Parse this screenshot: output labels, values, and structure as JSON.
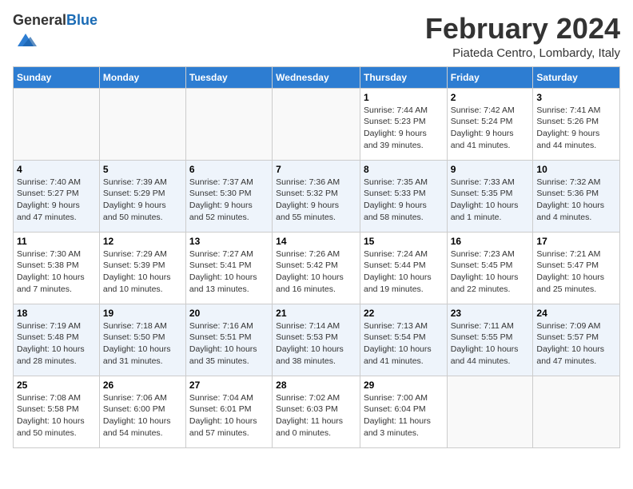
{
  "logo": {
    "general": "General",
    "blue": "Blue"
  },
  "header": {
    "month": "February 2024",
    "location": "Piateda Centro, Lombardy, Italy"
  },
  "weekdays": [
    "Sunday",
    "Monday",
    "Tuesday",
    "Wednesday",
    "Thursday",
    "Friday",
    "Saturday"
  ],
  "weeks": [
    [
      {
        "day": "",
        "info": ""
      },
      {
        "day": "",
        "info": ""
      },
      {
        "day": "",
        "info": ""
      },
      {
        "day": "",
        "info": ""
      },
      {
        "day": "1",
        "info": "Sunrise: 7:44 AM\nSunset: 5:23 PM\nDaylight: 9 hours\nand 39 minutes."
      },
      {
        "day": "2",
        "info": "Sunrise: 7:42 AM\nSunset: 5:24 PM\nDaylight: 9 hours\nand 41 minutes."
      },
      {
        "day": "3",
        "info": "Sunrise: 7:41 AM\nSunset: 5:26 PM\nDaylight: 9 hours\nand 44 minutes."
      }
    ],
    [
      {
        "day": "4",
        "info": "Sunrise: 7:40 AM\nSunset: 5:27 PM\nDaylight: 9 hours\nand 47 minutes."
      },
      {
        "day": "5",
        "info": "Sunrise: 7:39 AM\nSunset: 5:29 PM\nDaylight: 9 hours\nand 50 minutes."
      },
      {
        "day": "6",
        "info": "Sunrise: 7:37 AM\nSunset: 5:30 PM\nDaylight: 9 hours\nand 52 minutes."
      },
      {
        "day": "7",
        "info": "Sunrise: 7:36 AM\nSunset: 5:32 PM\nDaylight: 9 hours\nand 55 minutes."
      },
      {
        "day": "8",
        "info": "Sunrise: 7:35 AM\nSunset: 5:33 PM\nDaylight: 9 hours\nand 58 minutes."
      },
      {
        "day": "9",
        "info": "Sunrise: 7:33 AM\nSunset: 5:35 PM\nDaylight: 10 hours\nand 1 minute."
      },
      {
        "day": "10",
        "info": "Sunrise: 7:32 AM\nSunset: 5:36 PM\nDaylight: 10 hours\nand 4 minutes."
      }
    ],
    [
      {
        "day": "11",
        "info": "Sunrise: 7:30 AM\nSunset: 5:38 PM\nDaylight: 10 hours\nand 7 minutes."
      },
      {
        "day": "12",
        "info": "Sunrise: 7:29 AM\nSunset: 5:39 PM\nDaylight: 10 hours\nand 10 minutes."
      },
      {
        "day": "13",
        "info": "Sunrise: 7:27 AM\nSunset: 5:41 PM\nDaylight: 10 hours\nand 13 minutes."
      },
      {
        "day": "14",
        "info": "Sunrise: 7:26 AM\nSunset: 5:42 PM\nDaylight: 10 hours\nand 16 minutes."
      },
      {
        "day": "15",
        "info": "Sunrise: 7:24 AM\nSunset: 5:44 PM\nDaylight: 10 hours\nand 19 minutes."
      },
      {
        "day": "16",
        "info": "Sunrise: 7:23 AM\nSunset: 5:45 PM\nDaylight: 10 hours\nand 22 minutes."
      },
      {
        "day": "17",
        "info": "Sunrise: 7:21 AM\nSunset: 5:47 PM\nDaylight: 10 hours\nand 25 minutes."
      }
    ],
    [
      {
        "day": "18",
        "info": "Sunrise: 7:19 AM\nSunset: 5:48 PM\nDaylight: 10 hours\nand 28 minutes."
      },
      {
        "day": "19",
        "info": "Sunrise: 7:18 AM\nSunset: 5:50 PM\nDaylight: 10 hours\nand 31 minutes."
      },
      {
        "day": "20",
        "info": "Sunrise: 7:16 AM\nSunset: 5:51 PM\nDaylight: 10 hours\nand 35 minutes."
      },
      {
        "day": "21",
        "info": "Sunrise: 7:14 AM\nSunset: 5:53 PM\nDaylight: 10 hours\nand 38 minutes."
      },
      {
        "day": "22",
        "info": "Sunrise: 7:13 AM\nSunset: 5:54 PM\nDaylight: 10 hours\nand 41 minutes."
      },
      {
        "day": "23",
        "info": "Sunrise: 7:11 AM\nSunset: 5:55 PM\nDaylight: 10 hours\nand 44 minutes."
      },
      {
        "day": "24",
        "info": "Sunrise: 7:09 AM\nSunset: 5:57 PM\nDaylight: 10 hours\nand 47 minutes."
      }
    ],
    [
      {
        "day": "25",
        "info": "Sunrise: 7:08 AM\nSunset: 5:58 PM\nDaylight: 10 hours\nand 50 minutes."
      },
      {
        "day": "26",
        "info": "Sunrise: 7:06 AM\nSunset: 6:00 PM\nDaylight: 10 hours\nand 54 minutes."
      },
      {
        "day": "27",
        "info": "Sunrise: 7:04 AM\nSunset: 6:01 PM\nDaylight: 10 hours\nand 57 minutes."
      },
      {
        "day": "28",
        "info": "Sunrise: 7:02 AM\nSunset: 6:03 PM\nDaylight: 11 hours\nand 0 minutes."
      },
      {
        "day": "29",
        "info": "Sunrise: 7:00 AM\nSunset: 6:04 PM\nDaylight: 11 hours\nand 3 minutes."
      },
      {
        "day": "",
        "info": ""
      },
      {
        "day": "",
        "info": ""
      }
    ]
  ]
}
